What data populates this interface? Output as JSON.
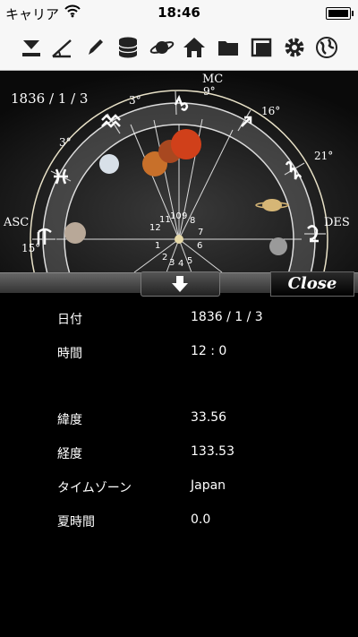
{
  "status_bar": {
    "carrier": "キャリア",
    "time": "18:46"
  },
  "toolbar": {
    "buttons": [
      {
        "icon": "download-icon"
      },
      {
        "icon": "angle-icon"
      },
      {
        "icon": "pencil-icon"
      },
      {
        "icon": "database-icon"
      },
      {
        "icon": "planet-icon"
      },
      {
        "icon": "home-icon"
      },
      {
        "icon": "folder-icon"
      },
      {
        "icon": "window-icon"
      },
      {
        "icon": "gear-icon"
      },
      {
        "icon": "globe-icon"
      }
    ]
  },
  "chart": {
    "date": "1836 / 1 / 3",
    "labels": {
      "mc": "MC",
      "mc_deg": "9°",
      "asc": "ASC",
      "des": "DES",
      "deg_3a": "3°",
      "deg_3b": "3°",
      "deg_16": "16°",
      "deg_21": "21°",
      "deg_15": "15°"
    },
    "houses": [
      "1",
      "2",
      "3",
      "4",
      "5",
      "6",
      "7",
      "8",
      "9",
      "10",
      "11",
      "12"
    ]
  },
  "panel": {
    "close_label": "Close"
  },
  "details": [
    {
      "label": "日付",
      "value": "1836 / 1 / 3"
    },
    {
      "label": "時間",
      "value": "12 : 0"
    },
    {
      "label": "緯度",
      "value": "33.56"
    },
    {
      "label": "経度",
      "value": "133.53"
    },
    {
      "label": "タイムゾーン",
      "value": "Japan"
    },
    {
      "label": "夏時間",
      "value": "0.0"
    }
  ]
}
